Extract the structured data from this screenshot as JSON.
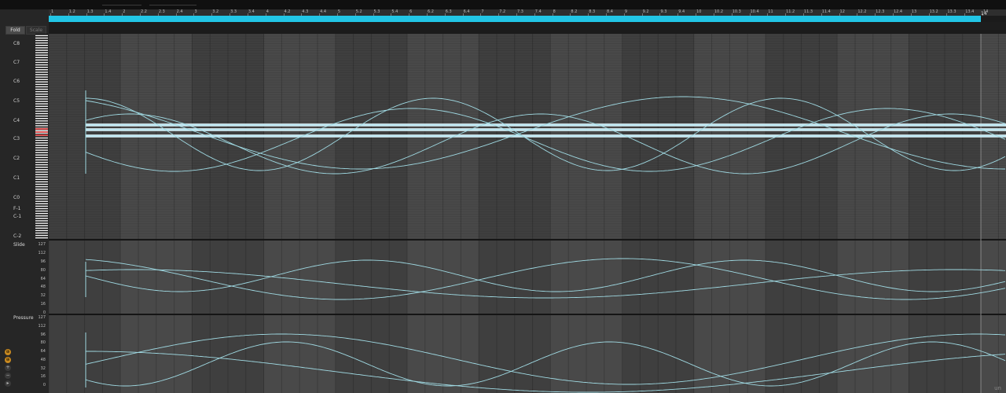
{
  "controls": {
    "fold_label": "Fold",
    "scale_label": "Scale",
    "icon_1": "⊕",
    "icon_2": "⊕",
    "icon_3": "+",
    "icon_4": "−",
    "icon_5": "▸"
  },
  "ruler": {
    "ticks": [
      "1",
      "1.2",
      "1.3",
      "1.4",
      "2",
      "2.2",
      "2.3",
      "2.4",
      "3",
      "3.2",
      "3.3",
      "3.4",
      "4",
      "4.2",
      "4.3",
      "4.4",
      "5",
      "5.2",
      "5.3",
      "5.4",
      "6",
      "6.2",
      "6.3",
      "6.4",
      "7",
      "7.2",
      "7.3",
      "7.4",
      "8",
      "8.2",
      "8.3",
      "8.4",
      "9",
      "9.2",
      "9.3",
      "9.4",
      "10",
      "10.2",
      "10.3",
      "10.4",
      "11",
      "11.2",
      "11.3",
      "11.4",
      "12",
      "12.2",
      "12.3",
      "12.4",
      "13",
      "13.2",
      "13.3",
      "13.4",
      "14"
    ],
    "end_label": "14"
  },
  "octaves": [
    "C8",
    "C7",
    "C6",
    "C5",
    "C4",
    "C3",
    "C2",
    "C1",
    "C0",
    "F-1",
    "C-1",
    "C-2"
  ],
  "lanes": {
    "slide": {
      "label": "Slide",
      "values": [
        "127",
        "112",
        "96",
        "80",
        "64",
        "48",
        "32",
        "16",
        "0"
      ]
    },
    "pressure": {
      "label": "Pressure",
      "values": [
        "127",
        "112",
        "96",
        "80",
        "64",
        "48",
        "32",
        "16",
        "0"
      ]
    }
  },
  "colors": {
    "accent": "#22c6e6",
    "curve": "#9fd9e2",
    "note": "#bfe7f2"
  },
  "watermark": "un"
}
